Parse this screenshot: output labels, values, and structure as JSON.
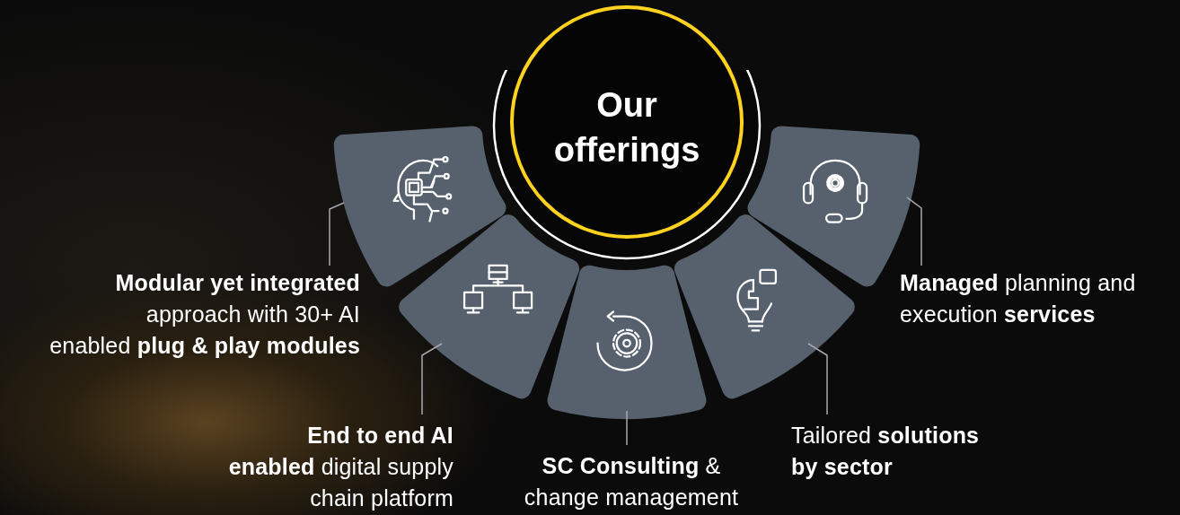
{
  "title": "Our\nofferings",
  "offerings": [
    {
      "kind": "ai-head",
      "text": "**Modular yet integrated**\napproach with 30+ AI\nenabled **plug & play modules**"
    },
    {
      "kind": "network",
      "text": "**End to end AI**\n**enabled** digital supply\nchain platform"
    },
    {
      "kind": "gear-cycle",
      "text": "**SC Consulting** &\nchange management"
    },
    {
      "kind": "bulb-puzzle",
      "text": "Tailored **solutions**\n**by sector**"
    },
    {
      "kind": "headset",
      "text": "**Managed** planning and\nexecution **services**"
    }
  ]
}
